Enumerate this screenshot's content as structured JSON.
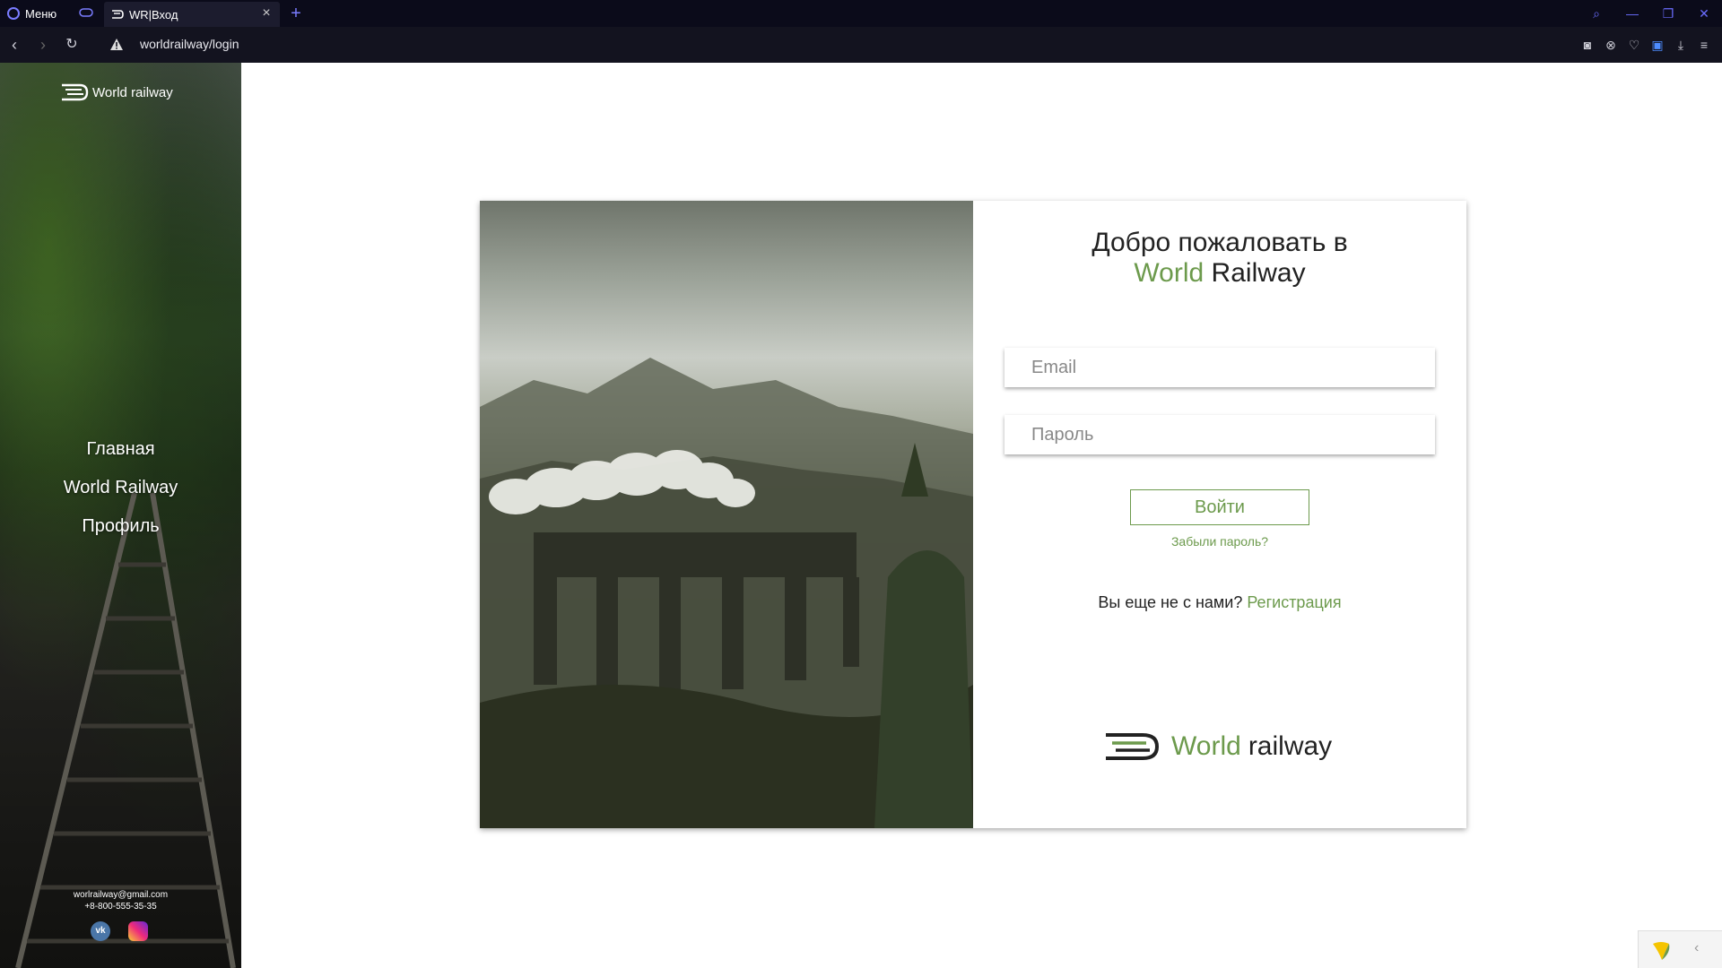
{
  "browser": {
    "menu_label": "Меню",
    "tab_title": "WR|Вход",
    "url": "worldrailway/login"
  },
  "sidebar": {
    "logo_text": "World railway",
    "nav": [
      {
        "label": "Главная"
      },
      {
        "label": "World Railway"
      },
      {
        "label": "Профиль"
      }
    ],
    "email": "worlrailway@gmail.com",
    "phone": "+8-800-555-35-35"
  },
  "login": {
    "welcome_line1": "Добро пожаловать в",
    "welcome_green": "World",
    "welcome_rest": " Railway",
    "email_placeholder": "Email",
    "password_placeholder": "Пароль",
    "submit_label": "Войти",
    "forgot_label": "Забыли пароль?",
    "not_with_us": "Вы еще не с нами? ",
    "register_label": "Регистрация",
    "brand_green": "World",
    "brand_rest": "railway"
  },
  "colors": {
    "accent": "#6c9a4c",
    "chrome_bg": "#0b0b1a"
  }
}
